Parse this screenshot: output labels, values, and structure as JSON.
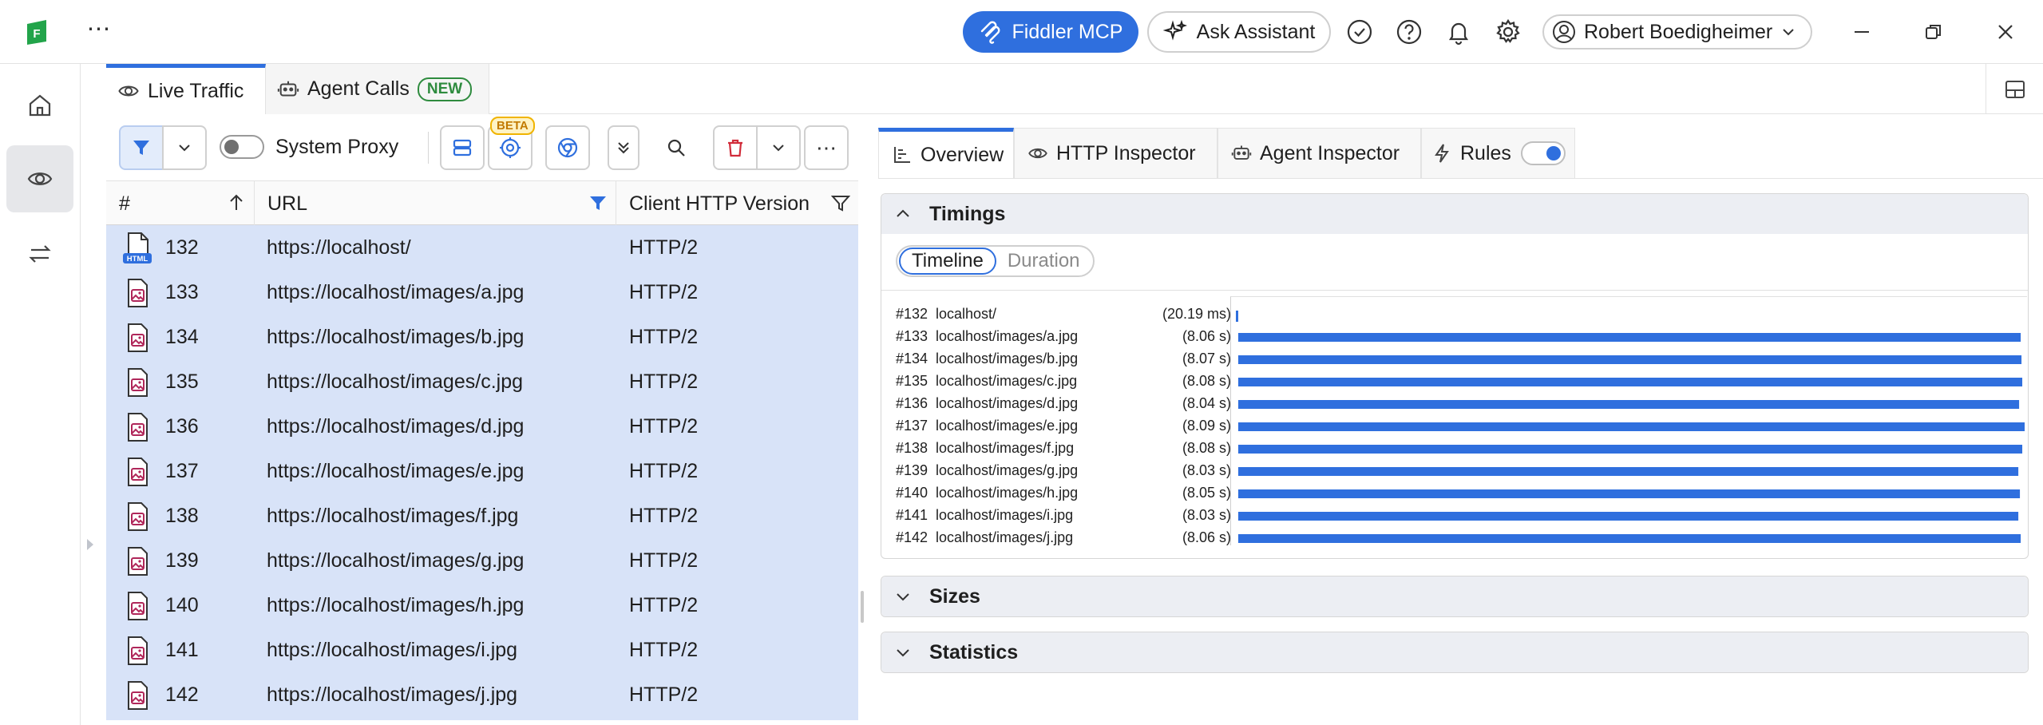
{
  "titlebar": {
    "mcp_label": "Fiddler MCP",
    "assistant_label": "Ask Assistant",
    "user_name": "Robert Boedigheimer",
    "logo_letter": "F"
  },
  "session_tabs": [
    {
      "label": "Live Traffic",
      "active": true
    },
    {
      "label": "Agent Calls",
      "badge": "NEW",
      "active": false
    }
  ],
  "toolbar": {
    "system_proxy_label": "System Proxy",
    "system_proxy_on": false,
    "beta_badge": "BETA"
  },
  "grid": {
    "columns": [
      "#",
      "URL",
      "Client HTTP Version"
    ],
    "rows": [
      {
        "num": "132",
        "url": "https://localhost/",
        "version": "HTTP/2",
        "type": "html",
        "type_badge": "HTML"
      },
      {
        "num": "133",
        "url": "https://localhost/images/a.jpg",
        "version": "HTTP/2",
        "type": "image"
      },
      {
        "num": "134",
        "url": "https://localhost/images/b.jpg",
        "version": "HTTP/2",
        "type": "image"
      },
      {
        "num": "135",
        "url": "https://localhost/images/c.jpg",
        "version": "HTTP/2",
        "type": "image"
      },
      {
        "num": "136",
        "url": "https://localhost/images/d.jpg",
        "version": "HTTP/2",
        "type": "image"
      },
      {
        "num": "137",
        "url": "https://localhost/images/e.jpg",
        "version": "HTTP/2",
        "type": "image"
      },
      {
        "num": "138",
        "url": "https://localhost/images/f.jpg",
        "version": "HTTP/2",
        "type": "image"
      },
      {
        "num": "139",
        "url": "https://localhost/images/g.jpg",
        "version": "HTTP/2",
        "type": "image"
      },
      {
        "num": "140",
        "url": "https://localhost/images/h.jpg",
        "version": "HTTP/2",
        "type": "image"
      },
      {
        "num": "141",
        "url": "https://localhost/images/i.jpg",
        "version": "HTTP/2",
        "type": "image"
      },
      {
        "num": "142",
        "url": "https://localhost/images/j.jpg",
        "version": "HTTP/2",
        "type": "image"
      }
    ]
  },
  "inspector_tabs": [
    {
      "label": "Overview",
      "active": true
    },
    {
      "label": "HTTP Inspector",
      "active": false
    },
    {
      "label": "Agent Inspector",
      "active": false
    },
    {
      "label": "Rules",
      "active": false,
      "toggle_on": true
    }
  ],
  "timings": {
    "title": "Timings",
    "segments": [
      "Timeline",
      "Duration"
    ],
    "active_segment": "Timeline",
    "entries": [
      {
        "id": "#132",
        "name": "localhost/",
        "duration": "(20.19 ms)",
        "start": 0.0,
        "end": 0.002
      },
      {
        "id": "#133",
        "name": "localhost/images/a.jpg",
        "duration": "(8.06 s)",
        "start": 0.003,
        "end": 0.995
      },
      {
        "id": "#134",
        "name": "localhost/images/b.jpg",
        "duration": "(8.07 s)",
        "start": 0.003,
        "end": 0.996
      },
      {
        "id": "#135",
        "name": "localhost/images/c.jpg",
        "duration": "(8.08 s)",
        "start": 0.003,
        "end": 0.997
      },
      {
        "id": "#136",
        "name": "localhost/images/d.jpg",
        "duration": "(8.04 s)",
        "start": 0.003,
        "end": 0.993
      },
      {
        "id": "#137",
        "name": "localhost/images/e.jpg",
        "duration": "(8.09 s)",
        "start": 0.003,
        "end": 1.0
      },
      {
        "id": "#138",
        "name": "localhost/images/f.jpg",
        "duration": "(8.08 s)",
        "start": 0.003,
        "end": 0.997
      },
      {
        "id": "#139",
        "name": "localhost/images/g.jpg",
        "duration": "(8.03 s)",
        "start": 0.003,
        "end": 0.992
      },
      {
        "id": "#140",
        "name": "localhost/images/h.jpg",
        "duration": "(8.05 s)",
        "start": 0.003,
        "end": 0.994
      },
      {
        "id": "#141",
        "name": "localhost/images/i.jpg",
        "duration": "(8.03 s)",
        "start": 0.003,
        "end": 0.992
      },
      {
        "id": "#142",
        "name": "localhost/images/j.jpg",
        "duration": "(8.06 s)",
        "start": 0.003,
        "end": 0.995
      }
    ]
  },
  "sections": {
    "sizes": "Sizes",
    "statistics": "Statistics"
  },
  "colors": {
    "accent": "#2f6fde",
    "selection": "#d8e3f8",
    "new_badge": "#2e8b3e",
    "beta_badge": "#f0b400",
    "logo": "#22a44a",
    "image_icon": "#b0275a"
  }
}
